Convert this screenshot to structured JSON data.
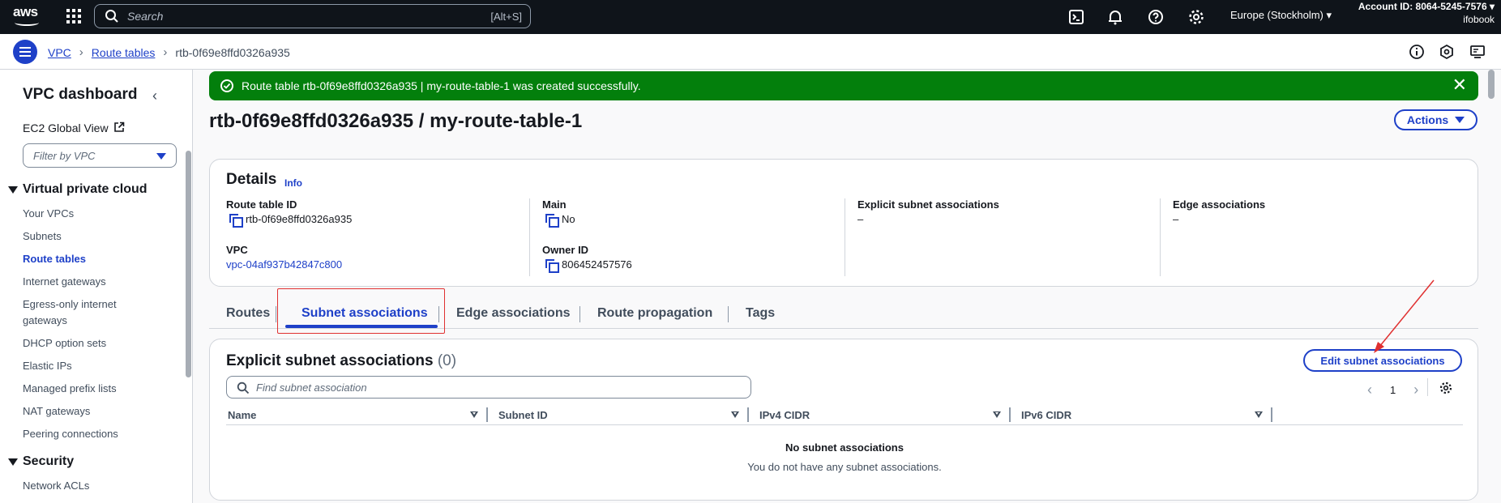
{
  "topbar": {
    "logo_text": "aws",
    "search_placeholder": "Search",
    "search_shortcut": "[Alt+S]",
    "region": "Europe (Stockholm)",
    "account_id": "Account ID: 8064-5245-7576",
    "account_user": "ifobook"
  },
  "breadcrumb": {
    "items": [
      "VPC",
      "Route tables"
    ],
    "current": "rtb-0f69e8ffd0326a935"
  },
  "sidebar": {
    "title": "VPC dashboard",
    "ec2_global": "EC2 Global View",
    "filter_placeholder": "Filter by VPC",
    "section1": "Virtual private cloud",
    "items": [
      "Your VPCs",
      "Subnets",
      "Route tables",
      "Internet gateways",
      "Egress-only internet gateways",
      "DHCP option sets",
      "Elastic IPs",
      "Managed prefix lists",
      "NAT gateways",
      "Peering connections"
    ],
    "active_item": "Route tables",
    "section2": "Security",
    "items2": [
      "Network ACLs"
    ]
  },
  "flash": {
    "message": "Route table rtb-0f69e8ffd0326a935 | my-route-table-1 was created successfully."
  },
  "page": {
    "title": "rtb-0f69e8ffd0326a935 / my-route-table-1",
    "actions_label": "Actions"
  },
  "details": {
    "heading": "Details",
    "info": "Info",
    "route_table_id_label": "Route table ID",
    "route_table_id": "rtb-0f69e8ffd0326a935",
    "vpc_label": "VPC",
    "vpc": "vpc-04af937b42847c800",
    "main_label": "Main",
    "main": "No",
    "owner_label": "Owner ID",
    "owner": "806452457576",
    "explicit_label": "Explicit subnet associations",
    "explicit": "–",
    "edge_label": "Edge associations",
    "edge": "–"
  },
  "tabs": [
    "Routes",
    "Subnet associations",
    "Edge associations",
    "Route propagation",
    "Tags"
  ],
  "assoc": {
    "heading": "Explicit subnet associations",
    "count": "(0)",
    "edit_label": "Edit subnet associations",
    "find_placeholder": "Find subnet association",
    "page": "1",
    "columns": [
      "Name",
      "Subnet ID",
      "IPv4 CIDR",
      "IPv6 CIDR"
    ],
    "empty_title": "No subnet associations",
    "empty_sub": "You do not have any subnet associations."
  },
  "colors": {
    "primary": "#1e40c8",
    "success": "#037f0c",
    "annotation": "#e03030"
  }
}
